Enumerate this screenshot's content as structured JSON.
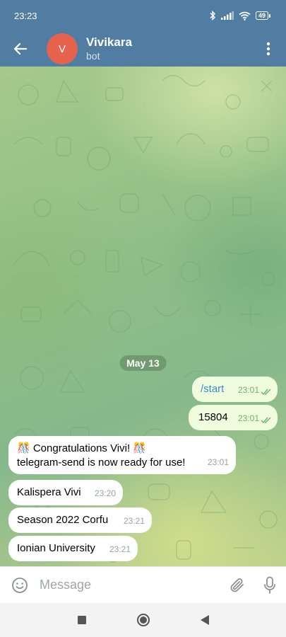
{
  "status_bar": {
    "time": "23:23",
    "battery": "49"
  },
  "header": {
    "avatar_letter": "V",
    "title": "Vivikara",
    "subtitle": "bot"
  },
  "chat": {
    "date_label": "May 13",
    "messages": [
      {
        "direction": "out",
        "text": "/start",
        "time": "23:01",
        "status": "read"
      },
      {
        "direction": "out",
        "text": "15804",
        "time": "23:01",
        "status": "read"
      },
      {
        "direction": "in",
        "line1": "🎊 Congratulations Vivi! 🎊",
        "line2": "telegram-send is now ready for use!",
        "time": "23:01"
      },
      {
        "direction": "in",
        "text": "Kalispera Vivi",
        "time": "23:20"
      },
      {
        "direction": "in",
        "text": "Season 2022 Corfu",
        "time": "23:21"
      },
      {
        "direction": "in",
        "text": "Ionian University",
        "time": "23:21"
      }
    ]
  },
  "input": {
    "placeholder": "Message"
  },
  "colors": {
    "header": "#517da2",
    "outgoing_bubble": "#effdde",
    "incoming_bubble": "#ffffff",
    "avatar": "#e5634d"
  },
  "icons": [
    "back-arrow-icon",
    "more-vert-icon",
    "emoji-icon",
    "attach-icon",
    "mic-icon",
    "bluetooth-icon",
    "signal-icon",
    "wifi-icon",
    "battery-icon",
    "nav-square-icon",
    "nav-home-icon",
    "nav-back-icon"
  ]
}
